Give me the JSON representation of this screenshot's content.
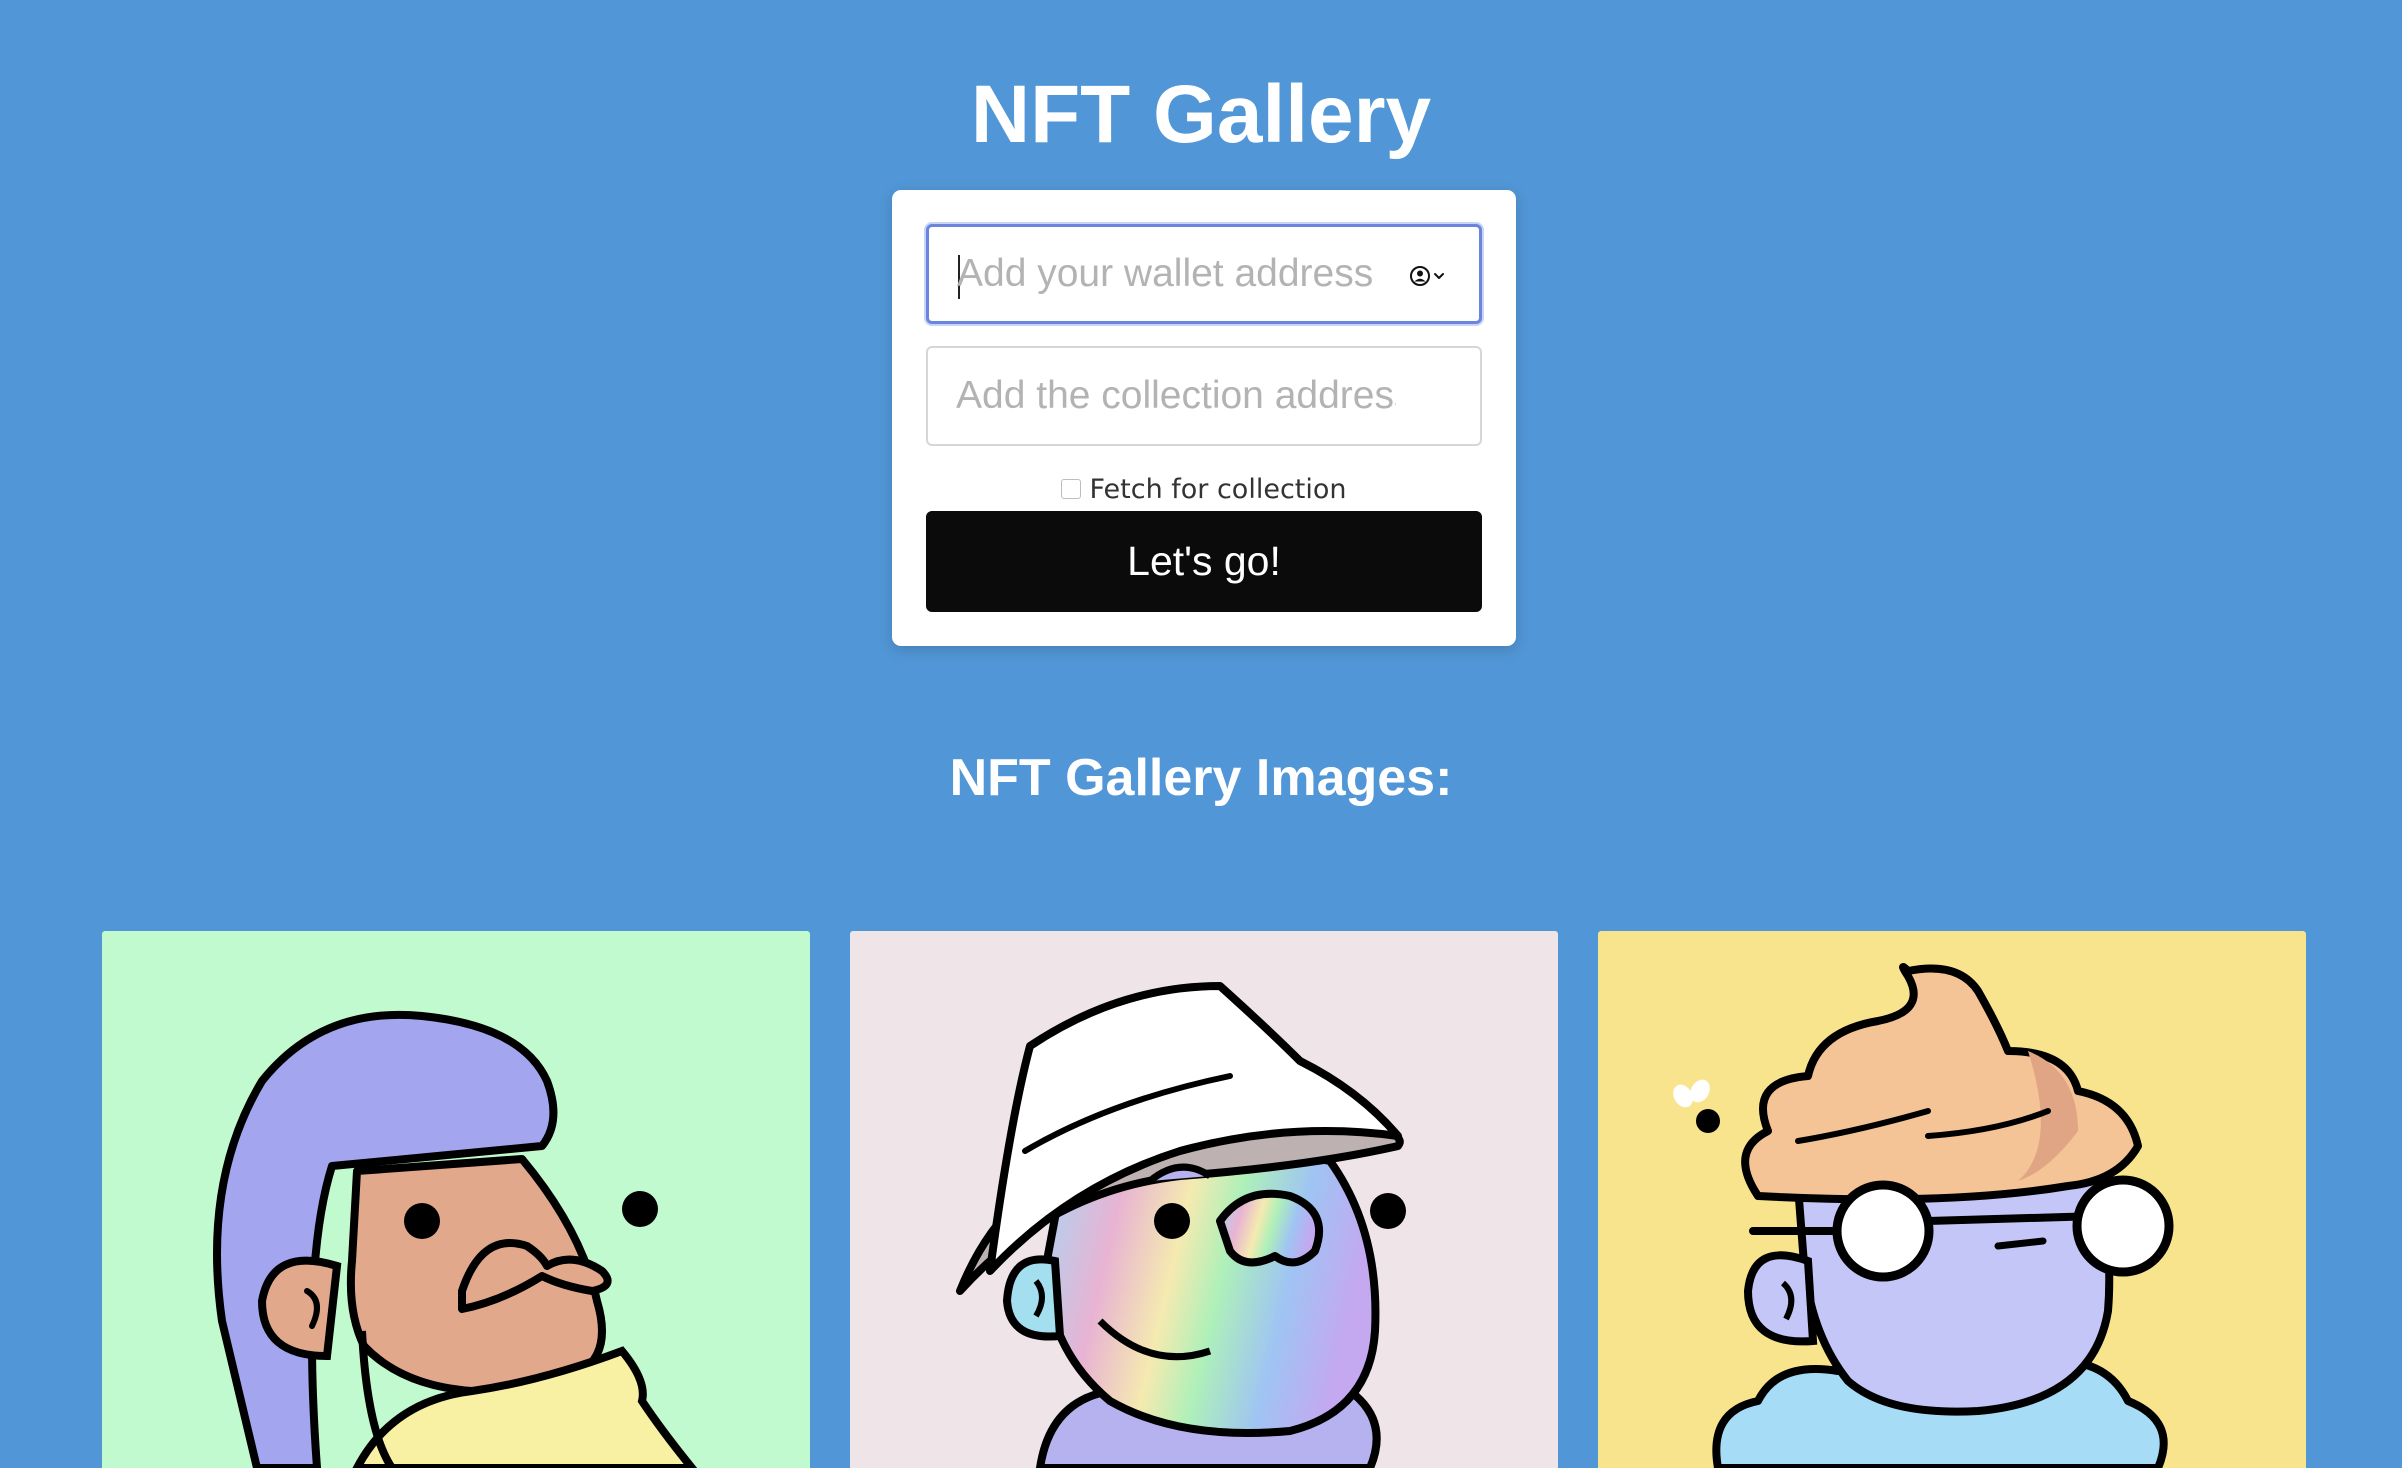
{
  "header": {
    "title": "NFT Gallery"
  },
  "form": {
    "wallet_placeholder": "Add your wallet address",
    "collection_placeholder": "Add the collection address",
    "checkbox_label": "Fetch for collection",
    "checkbox_checked": false,
    "submit_label": "Let's go!"
  },
  "gallery": {
    "title": "NFT Gallery Images:",
    "cards": [
      {
        "background": "#c2fad0",
        "icon": "purple-hair-character-avatar"
      },
      {
        "background": "#efe5e8",
        "icon": "bucket-hat-holographic-character-avatar"
      },
      {
        "background": "#f9e48e",
        "icon": "ice-cream-hair-glasses-character-avatar"
      }
    ]
  },
  "colors": {
    "page_background": "#5196d6",
    "button_background": "#0b0b0b",
    "focus_border": "#6a84e0"
  }
}
